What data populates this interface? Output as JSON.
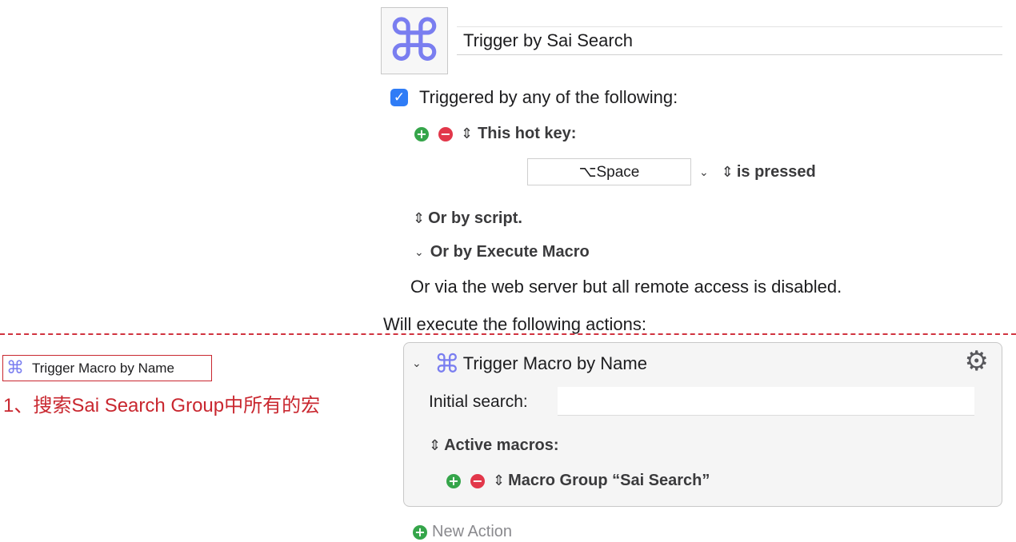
{
  "macro": {
    "icon": "command-icon",
    "name": "Trigger by Sai Search"
  },
  "triggers": {
    "checked": true,
    "header": "Triggered by any of the following:",
    "hotkey": {
      "label": "This hot key:",
      "key": "⌥Space",
      "condition": "is pressed"
    },
    "or_script": "Or by script.",
    "or_execute_macro": "Or by Execute Macro",
    "web_server_note": "Or via the web server but all remote access is disabled."
  },
  "actions": {
    "header": "Will execute the following actions:",
    "items": [
      {
        "title": "Trigger Macro by Name",
        "initial_search_label": "Initial search:",
        "initial_search_value": "",
        "active_macros_label": "Active macros:",
        "macro_group": "Macro Group “Sai Search”"
      }
    ],
    "new_action": "New Action"
  },
  "annotation": {
    "box_label": "Trigger Macro by Name",
    "note": "1、搜索Sai Search Group中所有的宏",
    "color": "#c9272f"
  },
  "colors": {
    "accent_blue": "#2f7cf6",
    "add_green": "#35a54a",
    "remove_red": "#e2374a",
    "command_icon": "#7a7ef0"
  }
}
